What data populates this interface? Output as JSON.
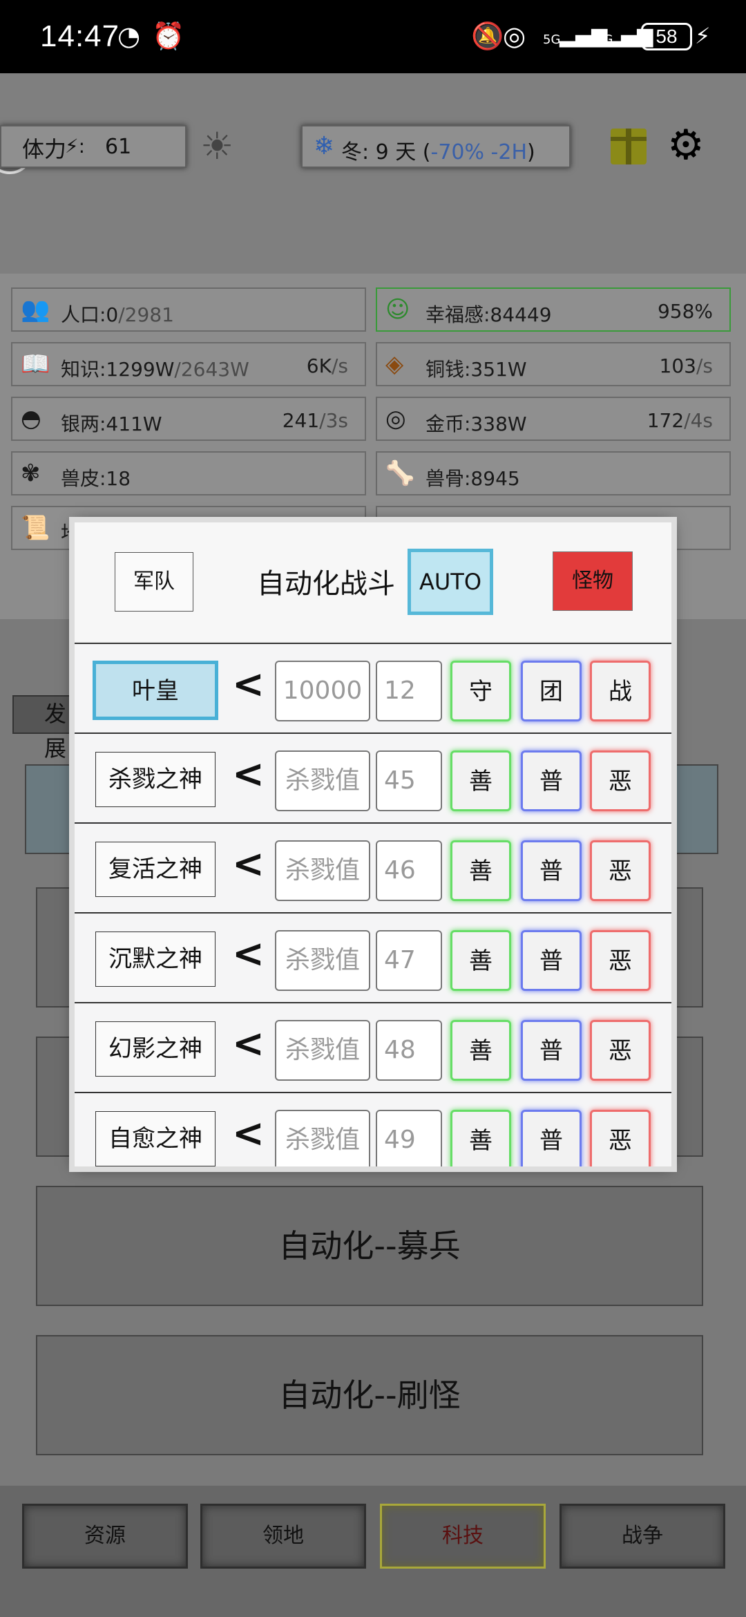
{
  "status_bar": {
    "time": "14:47",
    "battery": "58",
    "icons": [
      "speedometer-icon",
      "alarm-icon",
      "mute-icon",
      "hotspot-icon",
      "signal-5g-icon",
      "signal-4g-icon",
      "charging-icon"
    ],
    "network_5g": "5G",
    "network_4g": "4G"
  },
  "top_bar": {
    "stamina_label": "体力",
    "stamina_value": "61",
    "season_text": "冬: 9 天 (",
    "season_modifier": "-70% -2H",
    "season_close": ")"
  },
  "resources": [
    {
      "icon": "people-icon",
      "name": "人口:0",
      "max": "/2981",
      "rate": "",
      "unit": ""
    },
    {
      "icon": "smile-icon",
      "name": "幸福感:84449",
      "max": "",
      "rate": "958%",
      "unit": ""
    },
    {
      "icon": "book-icon",
      "name": "知识:1299W",
      "max": "/2643W",
      "rate": "6K",
      "unit": "/s"
    },
    {
      "icon": "copper-coin-icon",
      "name": "铜钱:351W",
      "max": "",
      "rate": "103",
      "unit": "/s"
    },
    {
      "icon": "silver-ingot-icon",
      "name": "银两:411W",
      "max": "",
      "rate": "241",
      "unit": "/3s"
    },
    {
      "icon": "gold-coin-icon",
      "name": "金币:338W",
      "max": "",
      "rate": "172",
      "unit": "/4s"
    },
    {
      "icon": "hide-icon",
      "name": "兽皮:18",
      "max": "",
      "rate": "",
      "unit": ""
    },
    {
      "icon": "bone-icon",
      "name": "兽骨:8945",
      "max": "",
      "rate": "",
      "unit": ""
    },
    {
      "icon": "scroll-icon",
      "name": "地契:",
      "max": "",
      "rate": "",
      "unit": ""
    }
  ],
  "background": {
    "develop_tab": "发展",
    "recruit_button": "自动化--募兵",
    "monster_button": "自动化--刷怪"
  },
  "modal": {
    "army_button": "军队",
    "title": "自动化战斗",
    "auto_button": "AUTO",
    "monster_button": "怪物",
    "first_row": {
      "name": "叶皇",
      "arrow": "<",
      "input1": "10000",
      "input2": "12",
      "b1": "守",
      "b2": "团",
      "b3": "战"
    },
    "rows": [
      {
        "name": "杀戮之神",
        "arrow": "<",
        "input1": "杀戮值",
        "input2": "45",
        "b1": "善",
        "b2": "普",
        "b3": "恶"
      },
      {
        "name": "复活之神",
        "arrow": "<",
        "input1": "杀戮值",
        "input2": "46",
        "b1": "善",
        "b2": "普",
        "b3": "恶"
      },
      {
        "name": "沉默之神",
        "arrow": "<",
        "input1": "杀戮值",
        "input2": "47",
        "b1": "善",
        "b2": "普",
        "b3": "恶"
      },
      {
        "name": "幻影之神",
        "arrow": "<",
        "input1": "杀戮值",
        "input2": "48",
        "b1": "善",
        "b2": "普",
        "b3": "恶"
      },
      {
        "name": "自愈之神",
        "arrow": "<",
        "input1": "杀戮值",
        "input2": "49",
        "b1": "善",
        "b2": "普",
        "b3": "恶"
      }
    ]
  },
  "bottom_nav": [
    "资源",
    "领地",
    "科技",
    "战争"
  ],
  "colors": {
    "auto_border": "#56b8d8",
    "monster_red": "#e23b3b",
    "good_green": "#66dd66",
    "normal_blue": "#6c7bee",
    "evil_red": "#ee6c6c",
    "active_nav": "#a9a83a"
  }
}
